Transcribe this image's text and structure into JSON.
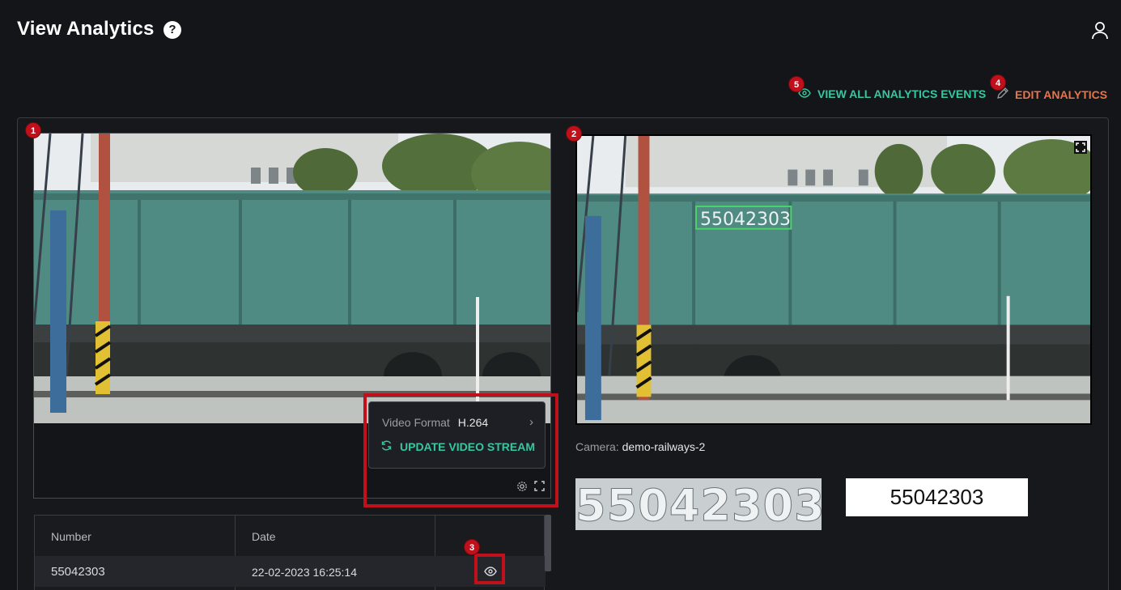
{
  "header": {
    "title": "View Analytics",
    "help_glyph": "?"
  },
  "actions": {
    "view_all_label": "VIEW ALL ANALYTICS EVENTS",
    "edit_label": "EDIT ANALYTICS",
    "view_all_color": "#35c8a0",
    "edit_color": "#e7744a"
  },
  "badges": [
    "1",
    "2",
    "3",
    "4",
    "5"
  ],
  "video_popup": {
    "format_label": "Video Format",
    "format_value": "H.264",
    "update_label": "UPDATE VIDEO STREAM"
  },
  "detection": {
    "box_text": "55042303"
  },
  "camera": {
    "label": "Camera:",
    "name": "demo-railways-2"
  },
  "result": {
    "plate_crop_text": "55042303",
    "recognized_text": "55042303"
  },
  "table": {
    "headers": [
      "Number",
      "Date",
      ""
    ],
    "rows": [
      {
        "number": "55042303",
        "date": "22-02-2023 16:25:14"
      }
    ]
  },
  "icons": [
    "help-icon",
    "user-icon",
    "eye-icon",
    "pencil-icon",
    "refresh-icon",
    "chevron-right-icon",
    "gear-icon",
    "fullscreen-icon"
  ]
}
